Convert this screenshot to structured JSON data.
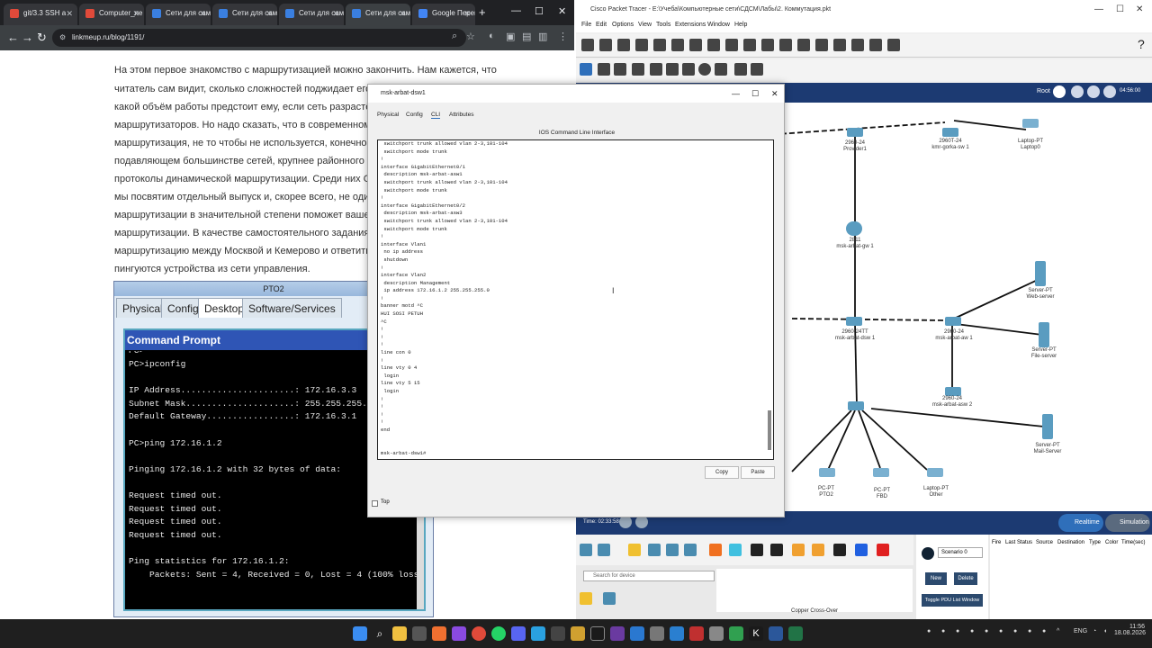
{
  "browser": {
    "tabs": [
      {
        "label": "git/3.3 SSH a",
        "color": "#e04a3a"
      },
      {
        "label": "Computer_ne",
        "color": "#e04a3a"
      },
      {
        "label": "Сети для сам",
        "color": "#3a7fe0"
      },
      {
        "label": "Сети для сам",
        "color": "#3a7fe0"
      },
      {
        "label": "Сети для сам",
        "color": "#3a7fe0"
      },
      {
        "label": "Сети для сам",
        "color": "#3a7fe0"
      },
      {
        "label": "Google Перев",
        "color": "#4285f4"
      }
    ],
    "new_tab": "+",
    "url": "linkmeup.ru/blog/1191/"
  },
  "article": {
    "lines": [
      "На этом первое знакомство с маршрутизацией можно закончить. Нам кажется, что",
      "читатель сам видит, сколько сложностей поджидает его здесь",
      "какой объём работы предстоит ему, если сеть разрастётся до",
      "маршрутизаторов. Но надо сказать, что в современном мире се",
      "маршрутизация, не то чтобы не используется, конечно, ей есть",
      "подавляющем большинстве сетей, крупнее районного пионерла",
      "протоколы динамической маршрутизации. Среди них OSPF, E",
      "мы посвятим отдельный выпуск и, скорее всего, не один. Но на",
      "маршрутизации в значительной степени поможет вашему обу",
      "маршрутизации. В качестве самостоятельного задания попро",
      "маршрутизацию между Москвой и Кемерово и ответить на во",
      "пингуются устройства из сети управления."
    ]
  },
  "pt02": {
    "title": "PTO2",
    "tabs": [
      "Physical",
      "Config",
      "Desktop",
      "Software/Services"
    ],
    "cmd_title": "Command Prompt",
    "cmd_lines": [
      "PC>",
      "PC>ipconfig",
      "",
      "IP Address......................: 172.16.3.3",
      "Subnet Mask.....................: 255.255.255.0",
      "Default Gateway.................: 172.16.3.1",
      "",
      "PC>ping 172.16.1.2",
      "",
      "Pinging 172.16.1.2 with 32 bytes of data:",
      "",
      "Request timed out.",
      "Request timed out.",
      "Request timed out.",
      "Request timed out.",
      "",
      "Ping statistics for 172.16.1.2:",
      "    Packets: Sent = 4, Received = 0, Lost = 4 (100% loss),"
    ]
  },
  "pt": {
    "title": "Cisco Packet Tracer - E:\\Учеба\\Компьютерные сети\\СДСМ\\Лабы\\2. Коммутация.pkt",
    "menu": [
      "File",
      "Edit",
      "Options",
      "View",
      "Tools",
      "Extensions",
      "Window",
      "Help"
    ],
    "root": "Root",
    "clock": "04:56:00",
    "time_label": "Time: 02:33:58",
    "realtime": "Realtime",
    "simulation": "Simulation",
    "search_placeholder": "Search for device",
    "cable_label": "Copper Cross-Over",
    "scenario": "Scenario 0",
    "new_btn": "New",
    "delete_btn": "Delete",
    "toggle_btn": "Toggle PDU List Window",
    "pdu_cols": [
      "Fire",
      "Last Status",
      "Source",
      "Destination",
      "Type",
      "Color",
      "Time(sec)"
    ],
    "devices": [
      {
        "label": "2960-24\nProvider1"
      },
      {
        "label": "2960T-24\nkmr-gorka-sw 1"
      },
      {
        "label": "Laptop-PT\nLaptop0"
      },
      {
        "label": "2811\nmsk-arbat-gw 1"
      },
      {
        "label": "Server-PT\nWeb-server"
      },
      {
        "label": "2960-24TT\nmsk-arbat-dsw 1"
      },
      {
        "label": "2960-24\nmsk-arbat-aw 1"
      },
      {
        "label": "Server-PT\nFile-server"
      },
      {
        "label": "2960-24\nmsk-arbat-asw 2"
      },
      {
        "label": "Server-PT\nMail-Server"
      },
      {
        "label": "PC-PT\nPTO2"
      },
      {
        "label": "PC-PT\nFBD"
      },
      {
        "label": "Laptop-PT\nOther"
      }
    ]
  },
  "ios": {
    "title": "msk-arbat-dsw1",
    "tabs": [
      "Physical",
      "Config",
      "CLI",
      "Attributes"
    ],
    "cli_header": "IOS Command Line Interface",
    "lines": [
      " switchport trunk allowed vlan 2-3,101-104",
      " switchport mode trunk",
      "!",
      "interface GigabitEthernet0/1",
      " description msk-arbat-asw1",
      " switchport trunk allowed vlan 2-3,101-104",
      " switchport mode trunk",
      "!",
      "interface GigabitEthernet0/2",
      " description msk-arbat-asw3",
      " switchport trunk allowed vlan 2-3,101-104",
      " switchport mode trunk",
      "!",
      "interface Vlan1",
      " no ip address",
      " shutdown",
      "!",
      "interface Vlan2",
      " description Management",
      " ip address 172.16.1.2 255.255.255.0",
      "!",
      "banner motd ^C",
      "HUI SOSI PETUH",
      "^C",
      "!",
      "!",
      "!",
      "line con 0",
      "!",
      "line vty 0 4",
      " login",
      "line vty 5 15",
      " login",
      "!",
      "!",
      "!",
      "!",
      "end",
      "",
      "",
      "msk-arbat-dsw1#"
    ],
    "copy": "Copy",
    "paste": "Paste",
    "top": "Top"
  },
  "taskbar": {
    "lang": "ENG",
    "time": "11:56",
    "date": "18.08.2026"
  }
}
